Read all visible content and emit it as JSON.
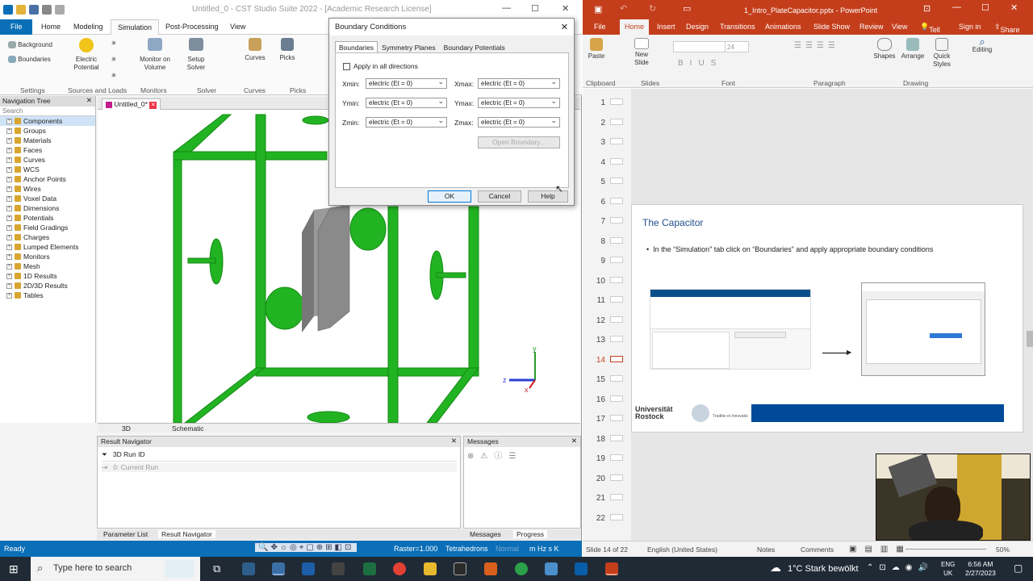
{
  "cst": {
    "title": "Untitled_0 - CST Studio Suite 2022 - [Academic Research License]",
    "tabs": [
      "File",
      "Home",
      "Modeling",
      "Simulation",
      "Post-Processing",
      "View"
    ],
    "ribbon": {
      "background": "Background",
      "boundaries": "Boundaries",
      "electric_potential": "Electric Potential",
      "monitor_on_volume": "Monitor on Volume",
      "setup_solver": "Setup Solver",
      "curves": "Curves",
      "picks": "Picks",
      "groups": [
        "Settings",
        "Sources and Loads",
        "Monitors",
        "Solver",
        "Curves",
        "Picks"
      ]
    },
    "nav_tree": {
      "title": "Navigation Tree",
      "search": "Search",
      "items": [
        "Components",
        "Groups",
        "Materials",
        "Faces",
        "Curves",
        "WCS",
        "Anchor Points",
        "Wires",
        "Voxel Data",
        "Dimensions",
        "Potentials",
        "Field Gradings",
        "Charges",
        "Lumped Elements",
        "Monitors",
        "Mesh",
        "1D Results",
        "2D/3D Results",
        "Tables"
      ]
    },
    "doc_tab": "Untitled_0*",
    "view_tabs": [
      "3D",
      "Schematic"
    ],
    "result_nav": {
      "title": "Result Navigator",
      "row1": "3D Run ID",
      "row2": "0: Current Run"
    },
    "messages": {
      "title": "Messages"
    },
    "bottom_tabs": [
      "Parameter List",
      "Result Navigator",
      "Messages",
      "Progress"
    ],
    "status": {
      "ready": "Ready",
      "raster": "Raster=1.000",
      "mesh": "Tetrahedrons",
      "normal": "Normal",
      "units": "m  Hz  s  K"
    },
    "axes": {
      "x": "x",
      "y": "y",
      "z": "z"
    },
    "colors": {
      "accent": "#0b6fb8",
      "model": "#22b322"
    }
  },
  "dialog": {
    "title": "Boundary Conditions",
    "tabs": [
      "Boundaries",
      "Symmetry Planes",
      "Boundary Potentials"
    ],
    "apply_all": "Apply in all directions",
    "labels": {
      "xmin": "Xmin:",
      "xmax": "Xmax:",
      "ymin": "Ymin:",
      "ymax": "Ymax:",
      "zmin": "Zmin:",
      "zmax": "Zmax:"
    },
    "value": "electric (Et = 0)",
    "open_boundary": "Open Boundary...",
    "ok": "OK",
    "cancel": "Cancel",
    "help": "Help"
  },
  "ppt": {
    "title": "1_Intro_PlateCapacitor.pptx - PowerPoint",
    "sign_in": "Sign in",
    "share": "Share",
    "tabs": [
      "File",
      "Home",
      "Insert",
      "Design",
      "Transitions",
      "Animations",
      "Slide Show",
      "Review",
      "View",
      "Tell me..."
    ],
    "ribbon": {
      "paste": "Paste",
      "new_slide": "New Slide",
      "shapes": "Shapes",
      "arrange": "Arrange",
      "quick_styles": "Quick Styles",
      "editing": "Editing",
      "font_size": "24",
      "groups": [
        "Clipboard",
        "Slides",
        "Font",
        "Paragraph",
        "Drawing"
      ]
    },
    "thumbs": [
      "1",
      "2",
      "3",
      "4",
      "5",
      "6",
      "7",
      "8",
      "9",
      "10",
      "11",
      "12",
      "13",
      "14",
      "15",
      "16",
      "17",
      "18",
      "19",
      "20",
      "21",
      "22"
    ],
    "slide": {
      "title": "The Capacitor",
      "bullet": "In the “Simulation” tab click on “Boundaries” and apply appropriate boundary conditions",
      "logo1": "Universität",
      "logo2": "Rostock",
      "logo3": "Traditio et Innovatio"
    },
    "status": {
      "slide": "Slide 14 of 22",
      "lang": "English (United States)",
      "notes": "Notes",
      "comments": "Comments",
      "zoom": "50%"
    }
  },
  "taskbar": {
    "search": "Type here to search",
    "weather": "1°C  Stark bewölkt",
    "lang": "ENG",
    "region": "UK",
    "time": "6:56 AM",
    "date": "2/27/2023"
  }
}
